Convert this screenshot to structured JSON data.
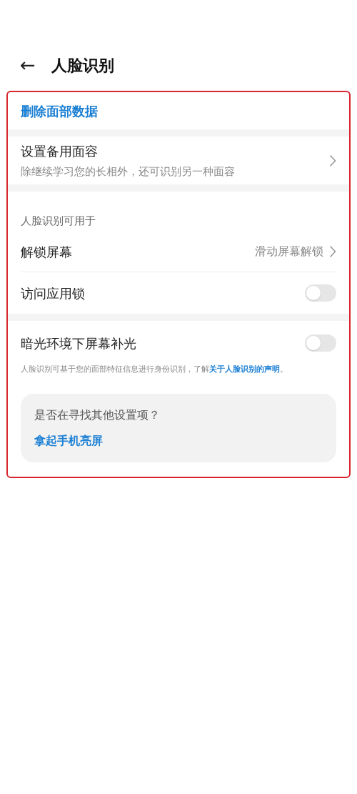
{
  "header": {
    "back": "←",
    "title": "人脸识别"
  },
  "delete_action": {
    "label": "删除面部数据"
  },
  "backup_face": {
    "title": "设置备用面容",
    "subtitle": "除继续学习您的长相外，还可识别另一种面容"
  },
  "usage": {
    "heading": "人脸识别可用于",
    "items": [
      {
        "kind": "value",
        "label": "解锁屏幕",
        "value": "滑动屏幕解锁"
      },
      {
        "kind": "toggle",
        "label": "访问应用锁",
        "on": false
      }
    ]
  },
  "dim_light": {
    "kind": "toggle",
    "label": "暗光环境下屏幕补光",
    "on": false
  },
  "note": {
    "text": "人脸识别可基于您的面部特征信息进行身份识别，了解",
    "link": "关于人脸识别的声明",
    "end": "。"
  },
  "suggestion": {
    "question": "是否在寻找其他设置项？",
    "link": "拿起手机亮屏"
  }
}
